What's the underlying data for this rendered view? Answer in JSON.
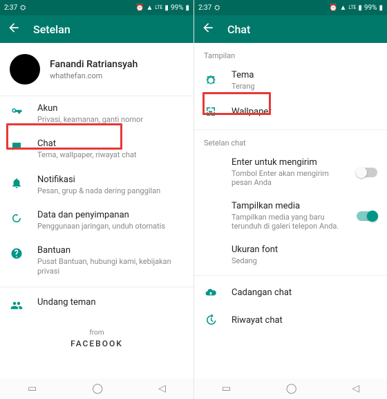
{
  "statusbar": {
    "time": "2:37",
    "battery": "99%"
  },
  "left": {
    "title": "Setelan",
    "profile": {
      "name": "Fanandi Ratriansyah",
      "sub": "whathefan.com"
    },
    "items": [
      {
        "key": "account",
        "title": "Akun",
        "sub": "Privasi, keamanan, ganti nomor"
      },
      {
        "key": "chat",
        "title": "Chat",
        "sub": "Tema, wallpaper, riwayat chat"
      },
      {
        "key": "notif",
        "title": "Notifikasi",
        "sub": "Pesan, grup & nada dering panggilan"
      },
      {
        "key": "data",
        "title": "Data dan penyimpanan",
        "sub": "Penggunaan jaringan, unduh otomatis"
      },
      {
        "key": "help",
        "title": "Bantuan",
        "sub": "Pusat Bantuan, hubungi kami, kebijakan privasi"
      },
      {
        "key": "invite",
        "title": "Undang teman",
        "sub": ""
      }
    ],
    "footer": {
      "from": "from",
      "brand": "FACEBOOK"
    }
  },
  "right": {
    "title": "Chat",
    "section_display": "Tampilan",
    "theme": {
      "title": "Tema",
      "value": "Terang"
    },
    "wallpaper": {
      "title": "Wallpaper"
    },
    "section_chat": "Setelan chat",
    "enter": {
      "title": "Enter untuk mengirim",
      "sub": "Tombol Enter akan mengirim pesan Anda",
      "on": false
    },
    "media": {
      "title": "Tampilkan media",
      "sub": "Tampilkan media yang baru terunduh di galeri telepon Anda.",
      "on": true
    },
    "font": {
      "title": "Ukuran font",
      "value": "Sedang"
    },
    "backup": {
      "title": "Cadangan chat"
    },
    "history": {
      "title": "Riwayat chat"
    }
  }
}
